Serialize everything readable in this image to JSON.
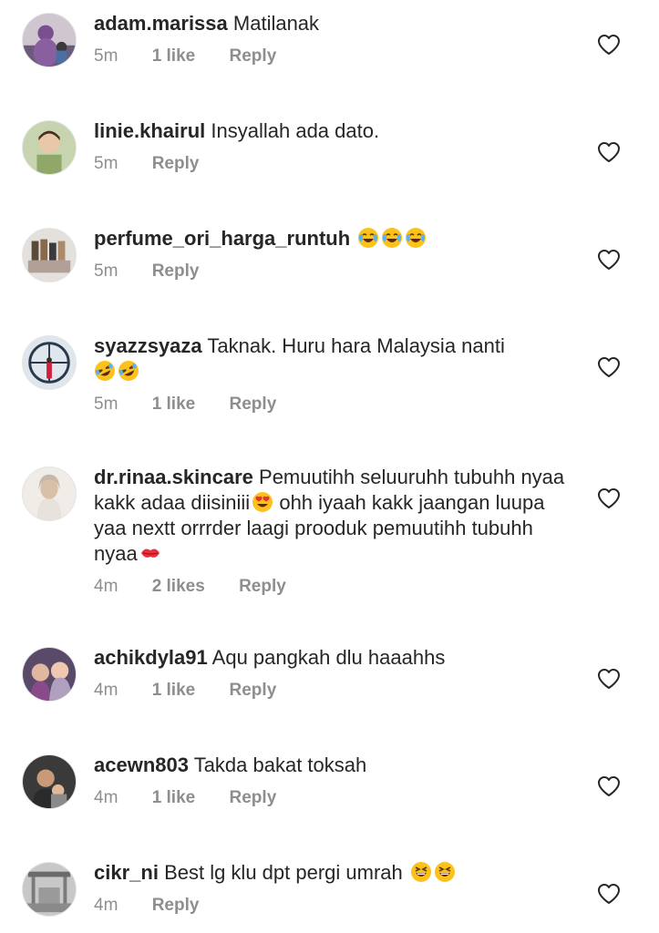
{
  "comments": [
    {
      "username": "adam.marissa",
      "text": "Matilanak",
      "emojis": [],
      "time": "5m",
      "likes": "1 like",
      "reply": "Reply",
      "avatar_color": "#6b5a7a"
    },
    {
      "username": "linie.khairul",
      "text": "Insyallah ada dato.",
      "emojis": [],
      "time": "5m",
      "likes": "",
      "reply": "Reply",
      "avatar_color": "#8fa86a"
    },
    {
      "username": "perfume_ori_harga_runtuh",
      "text": "",
      "emojis": [
        "tears-of-joy",
        "tears-of-joy",
        "tears-of-joy"
      ],
      "time": "5m",
      "likes": "",
      "reply": "Reply",
      "avatar_color": "#9a8f86"
    },
    {
      "username": "syazzsyaza",
      "text": "Taknak. Huru hara Malaysia nanti",
      "emojis": [
        "rolling-laughing",
        "rolling-laughing"
      ],
      "time": "5m",
      "likes": "1 like",
      "reply": "Reply",
      "avatar_color": "#b9c4cf"
    },
    {
      "username": "dr.rinaa.skincare",
      "text": "Pemuutihh seluuruhh tubuhh nyaa kakk  adaa diisiniii",
      "emojis": [
        "heart-eyes"
      ],
      "text2": "ohh iyaah kakk jaangan luupa yaa nextt orrrder laagi prooduk pemuutihh tubuhh nyaa",
      "emojis2": [
        "kiss-mark"
      ],
      "time": "4m",
      "likes": "2 likes",
      "reply": "Reply",
      "avatar_color": "#e8e2dc"
    },
    {
      "username": "achikdyla91",
      "text": "Aqu pangkah dlu haaahhs",
      "emojis": [],
      "time": "4m",
      "likes": "1 like",
      "reply": "Reply",
      "avatar_color": "#6a4a6e"
    },
    {
      "username": "acewn803",
      "text": "Takda bakat toksah",
      "emojis": [],
      "time": "4m",
      "likes": "1 like",
      "reply": "Reply",
      "avatar_color": "#4a4a4a"
    },
    {
      "username": "cikr_ni",
      "text": "Best lg klu dpt pergi umrah",
      "emojis": [
        "grinning-squint",
        "grinning-squint"
      ],
      "time": "4m",
      "likes": "",
      "reply": "Reply",
      "avatar_color": "#a8a8a8"
    }
  ]
}
